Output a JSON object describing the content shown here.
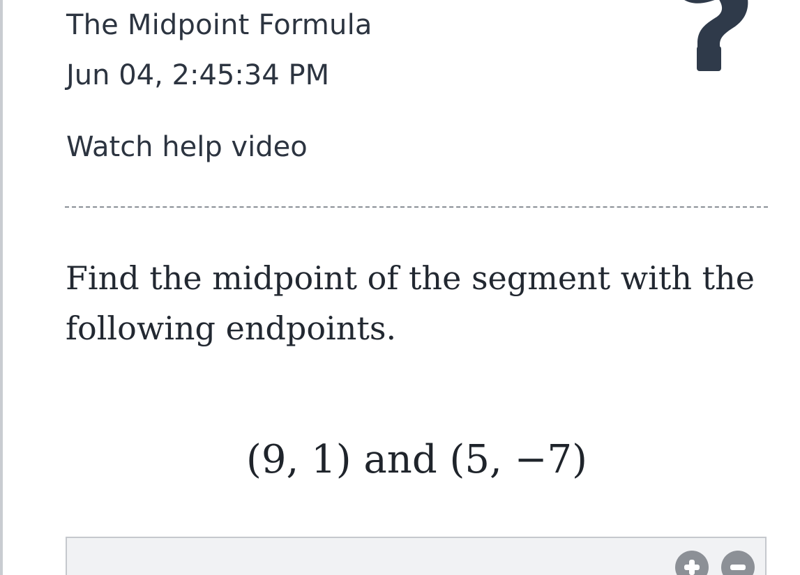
{
  "header": {
    "title": "The Midpoint Formula",
    "timestamp": "Jun 04, 2:45:34 PM",
    "help_link": "Watch help video",
    "help_icon": "question-mark-icon"
  },
  "question": {
    "prompt": "Find the midpoint of the segment with the following endpoints.",
    "expression": "(9, 1) and (5, −7)"
  },
  "answer_area": {
    "zoom_in_icon": "plus-icon",
    "zoom_out_icon": "minus-icon"
  },
  "colors": {
    "text": "#2c3440",
    "icon": "#2f3a4a",
    "answer_bg": "#f1f2f4",
    "zoom_button": "#8c9096"
  }
}
